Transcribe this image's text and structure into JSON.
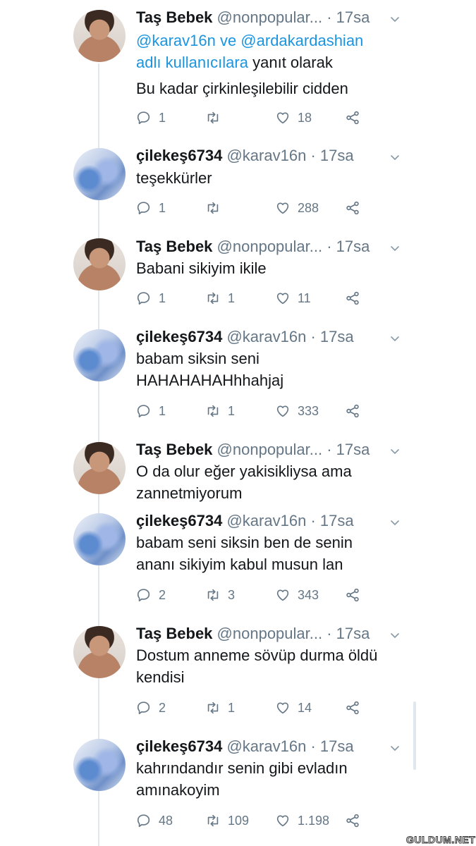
{
  "tweets": [
    {
      "name": "Taş Bebek",
      "handle": "@nonpopular...",
      "time": "· 17sa",
      "reply_prefix": "@karav16n ve @ardakardashian",
      "reply_link2": "adlı kullanıcılara",
      "reply_suffix": "yanıt olarak",
      "text1": "Bu kadar çirkinleşilebilir cidden",
      "text2": "",
      "replies": "1",
      "retweets": "",
      "likes": "18"
    },
    {
      "name": "çilekeş6734",
      "handle": "@karav16n",
      "time": "· 17sa",
      "text1": "teşekkürler",
      "text2": "",
      "replies": "1",
      "retweets": "",
      "likes": "288"
    },
    {
      "name": "Taş Bebek",
      "handle": "@nonpopular...",
      "time": "· 17sa",
      "text1": "Babani sikiyim ikile",
      "text2": "",
      "replies": "1",
      "retweets": "1",
      "likes": "11"
    },
    {
      "name": "çilekeş6734",
      "handle": "@karav16n",
      "time": "· 17sa",
      "text1": "babam siksin seni",
      "text2": "HAHAHAHAHhhahjaj",
      "replies": "1",
      "retweets": "1",
      "likes": "333"
    },
    {
      "name": "Taş Bebek",
      "handle": "@nonpopular...",
      "time": "· 17sa",
      "text1": "O da olur eğer yakisikliysa ama",
      "text2": "zannetmiyorum"
    },
    {
      "name": "çilekeş6734",
      "handle": "@karav16n",
      "time": "· 17sa",
      "text1": "babam seni siksin ben de senin",
      "text2": "ananı sikiyim kabul musun lan",
      "replies": "2",
      "retweets": "3",
      "likes": "343"
    },
    {
      "name": "Taş Bebek",
      "handle": "@nonpopular...",
      "time": "· 17sa",
      "text1": "Dostum anneme sövüp durma öldü",
      "text2": "kendisi",
      "replies": "2",
      "retweets": "1",
      "likes": "14"
    },
    {
      "name": "çilekeş6734",
      "handle": "@karav16n",
      "time": "· 17sa",
      "text1": "kahrındandır senin gibi evladın",
      "text2": "amınakoyim",
      "replies": "48",
      "retweets": "109",
      "likes": "1.198"
    }
  ],
  "watermark": "GULDUM.NET"
}
